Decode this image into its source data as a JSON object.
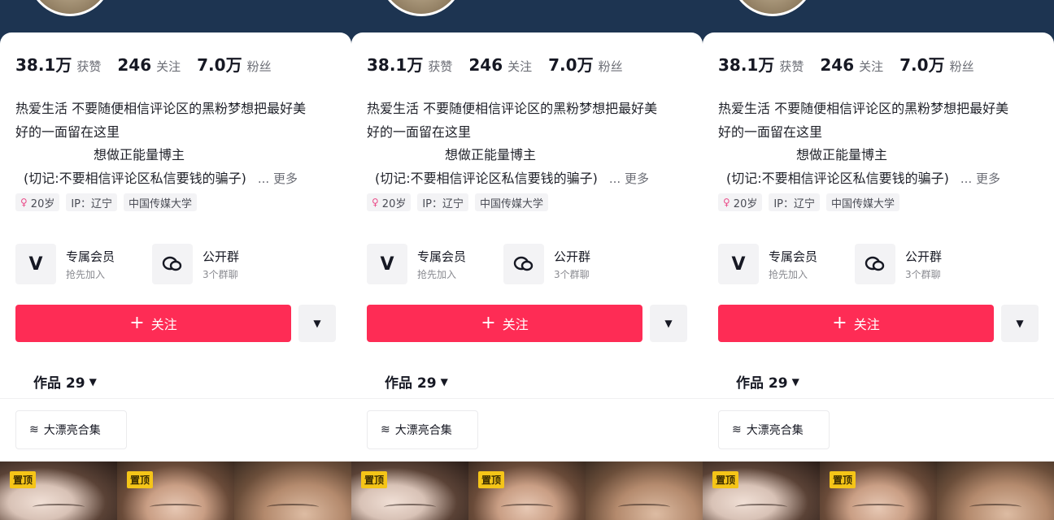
{
  "panels": [
    {
      "stats": [
        {
          "num": "38.1万",
          "label": "获赞"
        },
        {
          "num": "246",
          "label": "关注"
        },
        {
          "num": "7.0万",
          "label": "粉丝"
        }
      ],
      "bio": {
        "line1": "热爱生活   不要随便相信评论区的黑粉梦想把最好美",
        "line2": "好的一面留在这里",
        "line3": "想做正能量博主",
        "line4": "(切记:不要相信评论区私信要钱的骗子)",
        "more": "... 更多"
      },
      "tags": {
        "age": "20岁",
        "ip": "IP：辽宁",
        "school": "中国传媒大学"
      },
      "features": [
        {
          "title": "专属会员",
          "sub": "抢先加入"
        },
        {
          "title": "公开群",
          "sub": "3个群聊"
        }
      ],
      "follow_label": "关注",
      "works_label": "作品 29",
      "collection_label": "大漂亮合集",
      "pin_label": "置顶"
    },
    {
      "stats": [
        {
          "num": "38.1万",
          "label": "获赞"
        },
        {
          "num": "246",
          "label": "关注"
        },
        {
          "num": "7.0万",
          "label": "粉丝"
        }
      ],
      "bio": {
        "line1": "热爱生活   不要随便相信评论区的黑粉梦想把最好美",
        "line2": "好的一面留在这里",
        "line3": "想做正能量博主",
        "line4": "(切记:不要相信评论区私信要钱的骗子)",
        "more": "... 更多"
      },
      "tags": {
        "age": "20岁",
        "ip": "IP：辽宁",
        "school": "中国传媒大学"
      },
      "features": [
        {
          "title": "专属会员",
          "sub": "抢先加入"
        },
        {
          "title": "公开群",
          "sub": "3个群聊"
        }
      ],
      "follow_label": "关注",
      "works_label": "作品 29",
      "collection_label": "大漂亮合集",
      "pin_label": "置顶"
    },
    {
      "stats": [
        {
          "num": "38.1万",
          "label": "获赞"
        },
        {
          "num": "246",
          "label": "关注"
        },
        {
          "num": "7.0万",
          "label": "粉丝"
        }
      ],
      "bio": {
        "line1": "热爱生活   不要随便相信评论区的黑粉梦想把最好美",
        "line2": "好的一面留在这里",
        "line3": "想做正能量博主",
        "line4": "(切记:不要相信评论区私信要钱的骗子)",
        "more": "... 更多"
      },
      "tags": {
        "age": "20岁",
        "ip": "IP：辽宁",
        "school": "中国传媒大学"
      },
      "features": [
        {
          "title": "专属会员",
          "sub": "抢先加入"
        },
        {
          "title": "公开群",
          "sub": "3个群聊"
        }
      ],
      "follow_label": "关注",
      "works_label": "作品 29",
      "collection_label": "大漂亮合集",
      "pin_label": "置顶"
    }
  ],
  "colors": {
    "follow_button": "#fe2c55",
    "pin_badge": "#f5c518",
    "header_bg": "#1c3553"
  },
  "icons": {
    "gender": "female-icon",
    "member": "v-logo-icon",
    "group": "chat-bubble-icon",
    "collection": "layers-icon",
    "dropdown": "caret-down-icon",
    "follow": "plus-icon"
  }
}
